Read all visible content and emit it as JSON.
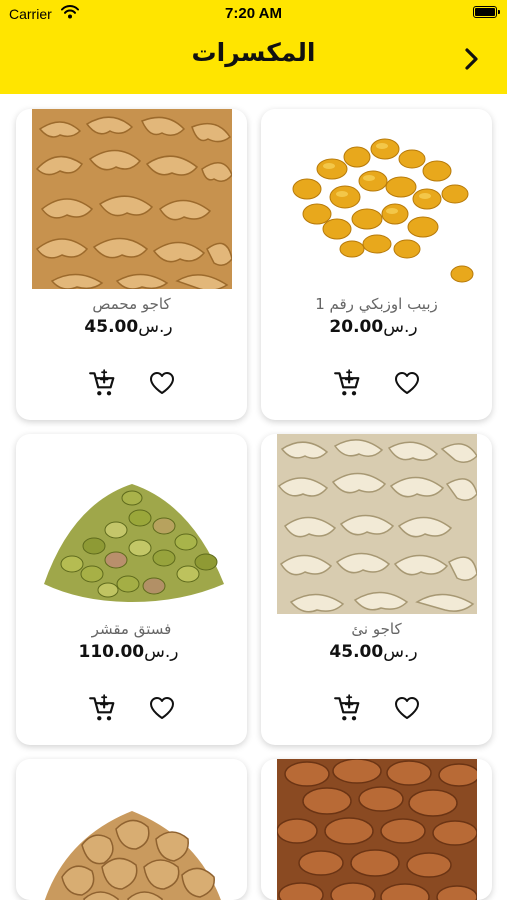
{
  "status_bar": {
    "carrier": "Carrier",
    "time": "7:20 AM"
  },
  "header": {
    "title": "المكسرات"
  },
  "currency": "ر.س",
  "colors": {
    "header_bg": "#ffe500",
    "card_shadow": "rgba(0,0,0,0.18)"
  },
  "products": [
    {
      "name": "زبيب اوزبكي رقم 1",
      "price": "20.00",
      "image": "golden-raisins"
    },
    {
      "name": "كاجو محمص",
      "price": "45.00",
      "image": "roasted-cashews"
    },
    {
      "name": "كاجو نئ",
      "price": "45.00",
      "image": "raw-cashews"
    },
    {
      "name": "فستق مقشر",
      "price": "110.00",
      "image": "shelled-pistachios"
    },
    {
      "name": "",
      "price": "",
      "image": "almonds"
    },
    {
      "name": "",
      "price": "",
      "image": "walnuts"
    }
  ]
}
